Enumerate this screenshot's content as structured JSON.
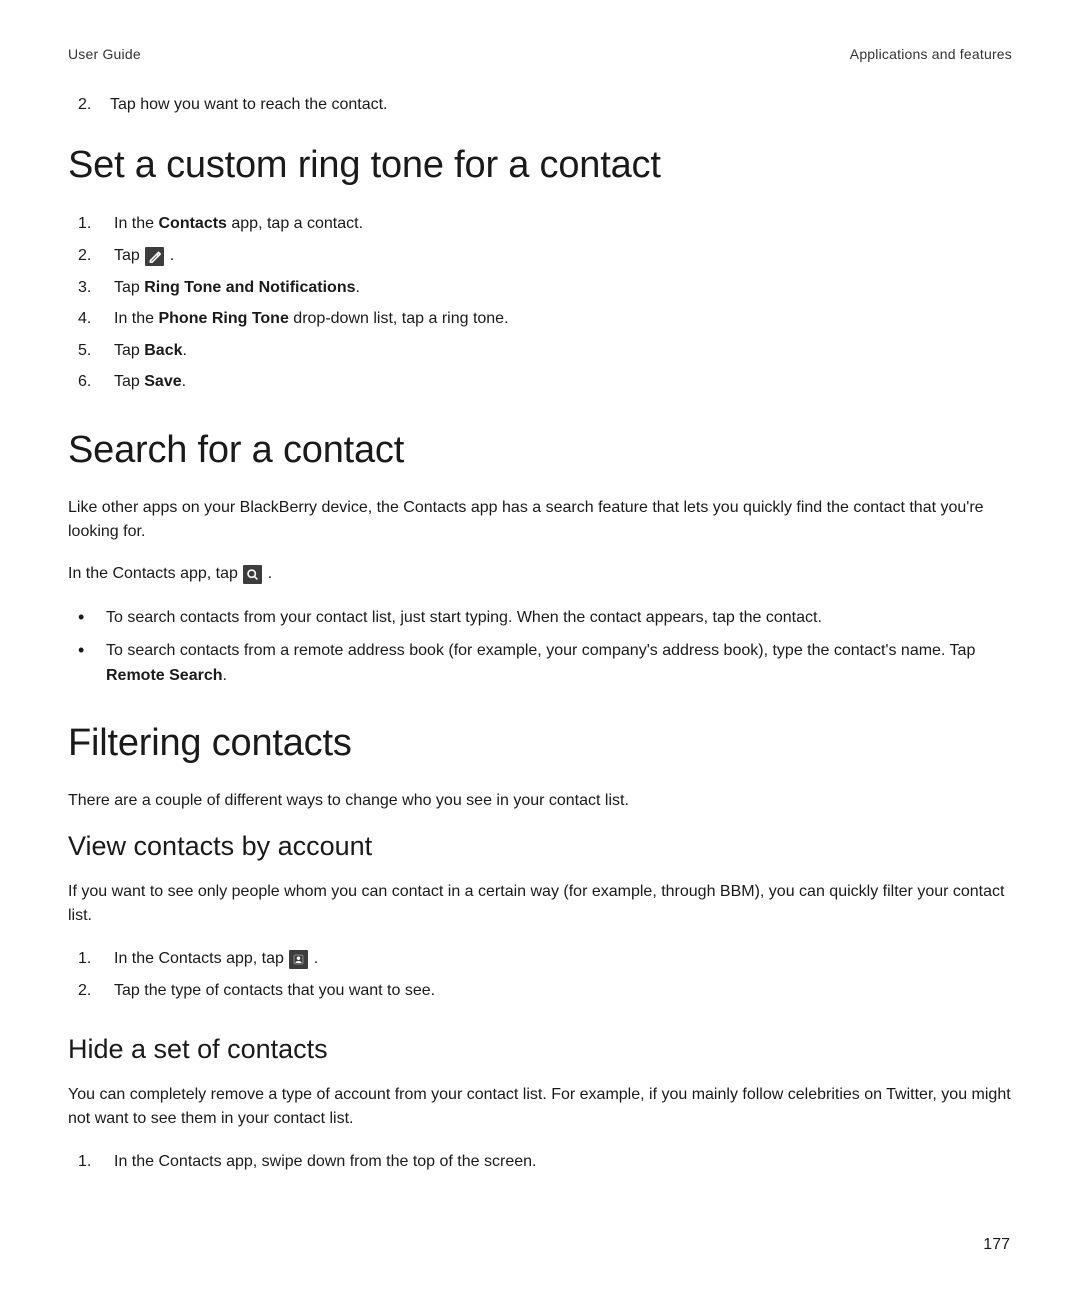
{
  "header": {
    "left": "User Guide",
    "right": "Applications and features"
  },
  "top_continuation": {
    "num": "2.",
    "text": "Tap how you want to reach the contact."
  },
  "s1": {
    "title": "Set a custom ring tone for a contact",
    "steps": [
      {
        "num": "1.",
        "pre": "In the ",
        "bold": "Contacts",
        "post": " app, tap a contact."
      },
      {
        "num": "2.",
        "pre": "Tap ",
        "icon": "edit",
        "post": "."
      },
      {
        "num": "3.",
        "pre": "Tap ",
        "bold": "Ring Tone and Notifications",
        "post": "."
      },
      {
        "num": "4.",
        "pre": "In the ",
        "bold": "Phone Ring Tone",
        "post": " drop-down list, tap a ring tone."
      },
      {
        "num": "5.",
        "pre": "Tap ",
        "bold": "Back",
        "post": "."
      },
      {
        "num": "6.",
        "pre": "Tap ",
        "bold": "Save",
        "post": "."
      }
    ]
  },
  "s2": {
    "title": "Search for a contact",
    "intro": "Like other apps on your BlackBerry device, the Contacts app has a search feature that lets you quickly find the contact that you're looking for.",
    "line2_pre": "In the Contacts app, tap ",
    "line2_post": ".",
    "bullets": [
      {
        "text": "To search contacts from your contact list, just start typing. When the contact appears, tap the contact."
      },
      {
        "pre": "To search contacts from a remote address book (for example, your company's address book), type the contact's name. Tap ",
        "bold": "Remote Search",
        "post": "."
      }
    ]
  },
  "s3": {
    "title": "Filtering contacts",
    "intro": "There are a couple of different ways to change who you see in your contact list.",
    "sub1": {
      "title": "View contacts by account",
      "intro": "If you want to see only people whom you can contact in a certain way (for example, through BBM), you can quickly filter your contact list.",
      "steps": [
        {
          "num": "1.",
          "pre": "In the Contacts app, tap ",
          "icon": "contact",
          "post": "."
        },
        {
          "num": "2.",
          "text": "Tap the type of contacts that you want to see."
        }
      ]
    },
    "sub2": {
      "title": "Hide a set of contacts",
      "intro": "You can completely remove a type of account from your contact list. For example, if you mainly follow celebrities on Twitter, you might not want to see them in your contact list.",
      "steps": [
        {
          "num": "1.",
          "text": "In the Contacts app, swipe down from the top of the screen."
        }
      ]
    }
  },
  "page_number": "177"
}
